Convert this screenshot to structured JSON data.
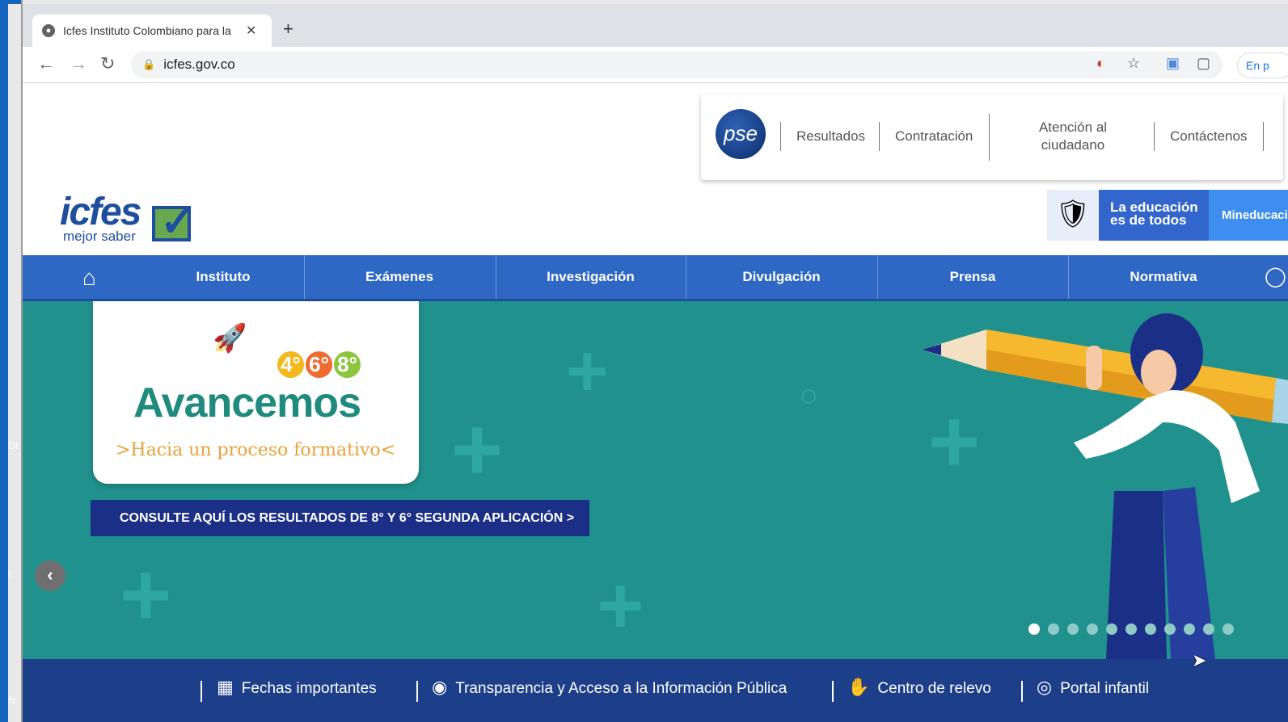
{
  "desktop": {
    "left_text_1": "DI",
    "left_text_2": "I",
    "left_text_3": "fc"
  },
  "browser": {
    "tab_title": "Icfes Instituto Colombiano para la",
    "new_tab": "+",
    "url": "icfes.gov.co",
    "extension_label": "En p"
  },
  "header": {
    "pse_label": "pse",
    "links": [
      "Resultados",
      "Contratación",
      "Atención al ciudadano",
      "Contáctenos"
    ],
    "logo_word": "icfes",
    "logo_sub": "mejor saber",
    "gov_line1": "La educación",
    "gov_line2": "es de todos",
    "mineducacion": "Mineducación"
  },
  "nav": {
    "items": [
      "Instituto",
      "Exámenes",
      "Investigación",
      "Divulgación",
      "Prensa",
      "Normativa"
    ]
  },
  "hero": {
    "card_title": "Avancemos",
    "card_subtitle": ">Hacia un proceso formativo<",
    "grades": [
      "4°",
      "6°",
      "8°"
    ],
    "cta": "CONSULTE AQUÍ LOS RESULTADOS DE 8° Y 6° SEGUNDA APLICACIÓN >",
    "slide_count": 11,
    "active_slide": 1
  },
  "footer": {
    "items": [
      "Fechas importantes",
      "Transparencia y Acceso a la Información Pública",
      "Centro de relevo",
      "Portal infantil"
    ]
  },
  "colors": {
    "nav_blue": "#2e67c4",
    "hero_teal": "#21918d",
    "footer_navy": "#1d3f89",
    "cta_navy": "#1c2f86"
  }
}
